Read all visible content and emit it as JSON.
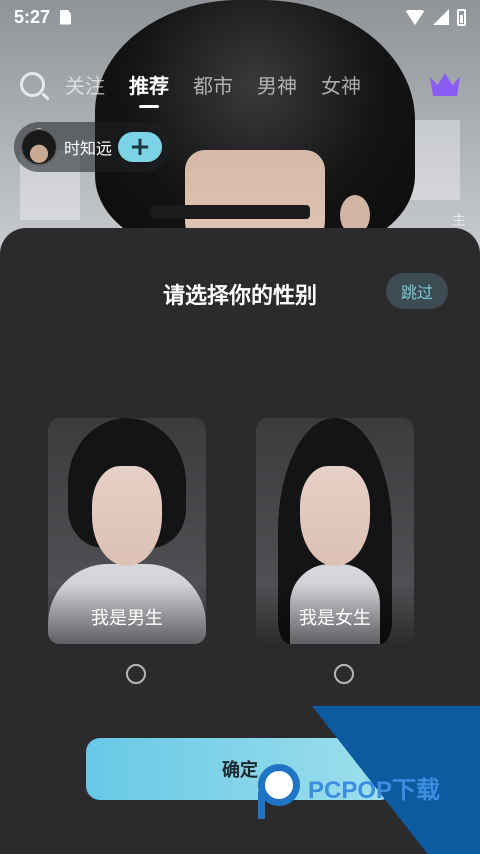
{
  "status_bar": {
    "time": "5:27",
    "icons": [
      "sim-card-icon",
      "wifi-icon",
      "signal-icon",
      "battery-charging-icon"
    ]
  },
  "top_nav": {
    "tabs": [
      {
        "label": "关注",
        "active": false
      },
      {
        "label": "推荐",
        "active": true
      },
      {
        "label": "都市",
        "active": false
      },
      {
        "label": "男神",
        "active": false
      },
      {
        "label": "女神",
        "active": false
      }
    ],
    "icons": [
      "search-icon",
      "crown-icon"
    ]
  },
  "character": {
    "name": "时知远",
    "add_label": "+"
  },
  "background_glyph": "主",
  "gender_modal": {
    "title": "请选择你的性别",
    "skip_label": "跳过",
    "options": [
      {
        "label": "我是男生",
        "selected": false
      },
      {
        "label": "我是女生",
        "selected": false
      }
    ],
    "confirm_label": "确定"
  },
  "watermark": {
    "text": "PCPOP下载"
  },
  "colors": {
    "accent": "#7fd3e6",
    "crown": "#8a5cf2",
    "sheet_bg": "#2b2b2d",
    "skip_text": "#79c9dc"
  }
}
